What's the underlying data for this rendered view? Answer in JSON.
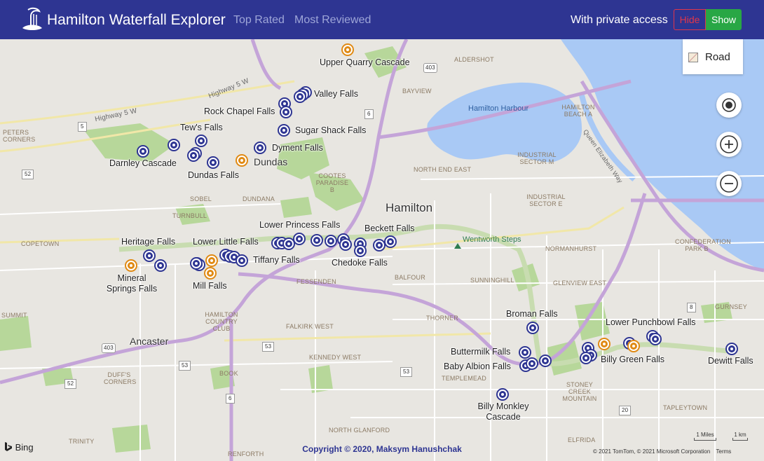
{
  "app": {
    "title": "Hamilton Waterfall Explorer",
    "nav": [
      "Top Rated",
      "Most Reviewed"
    ],
    "access_label": "With private access",
    "hide_label": "Hide",
    "show_label": "Show",
    "colors": {
      "header": "#2e3592",
      "hide": "#e0364a",
      "show": "#28a745",
      "pin_public": "#2e3592",
      "pin_private": "#e08a14"
    }
  },
  "map": {
    "style_label": "Road",
    "city": "Hamilton",
    "towns": [
      "Dundas",
      "Ancaster"
    ],
    "water": "Hamilton Harbour",
    "park": "Wentworth Steps",
    "roads": [
      "Highway 5 W",
      "Highway 5 W",
      "Queen Elizabeth Way"
    ],
    "shields": [
      "403",
      "6",
      "5",
      "52",
      "403",
      "53",
      "53",
      "53",
      "52",
      "6",
      "8",
      "20"
    ],
    "neighbourhoods": [
      "ALDERSHOT",
      "BAYVIEW",
      "PETERS CORNERS",
      "HAMILTON BEACH A",
      "NORTH END EAST",
      "INDUSTRIAL SECTOR M",
      "INDUSTRIAL SECTOR E",
      "COOTES PARADISE B",
      "SOBEL",
      "DUNDANA",
      "TURNBULL",
      "COPETOWN",
      "CONFEDERATION PARK B",
      "NORMANHURST",
      "GLENVIEW EAST",
      "FESSENDEN",
      "BALFOUR",
      "SUNNINGHILL",
      "SUMMIT",
      "HAMILTON COUNTRY CLUB",
      "FALKIRK WEST",
      "THORNER",
      "GURNSEY",
      "KENNEDY WEST",
      "DUFF'S CORNERS",
      "BOOK",
      "TEMPLEMEAD",
      "STONEY CREEK MOUNTAIN",
      "TAPLEYTOWN",
      "NORTH GLANFORD",
      "TRINITY",
      "RENFORTH",
      "ELFRIDA"
    ],
    "labels": [
      "Upper Quarry Cascade",
      "Valley Falls",
      "Rock Chapel Falls",
      "Sugar Shack Falls",
      "Tew's Falls",
      "Dyment Falls",
      "Darnley Cascade",
      "Dundas Falls",
      "Heritage Falls",
      "Lower Little Falls",
      "Lower Princess Falls",
      "Beckett Falls",
      "Tiffany Falls",
      "Chedoke Falls",
      "Mineral Springs Falls",
      "Mill Falls",
      "Broman Falls",
      "Lower Punchbowl Falls",
      "Buttermilk Falls",
      "Baby Albion Falls",
      "Billy Green Falls",
      "Dewitt Falls",
      "Billy Monkley Cascade"
    ],
    "pin_kinds": [
      "orange",
      "blue",
      "blue",
      "blue",
      "blue",
      "blue",
      "blue",
      "blue",
      "blue",
      "blue",
      "blue",
      "blue",
      "blue",
      "orange",
      "blue",
      "orange",
      "blue",
      "blue",
      "blue",
      "blue",
      "blue",
      "blue",
      "blue",
      "blue",
      "blue",
      "blue",
      "blue",
      "blue",
      "blue",
      "blue",
      "blue",
      "blue",
      "blue",
      "blue",
      "blue",
      "orange",
      "blue",
      "orange",
      "orange",
      "blue",
      "blue",
      "blue",
      "blue",
      "blue",
      "blue",
      "blue",
      "blue",
      "blue",
      "orange",
      "blue",
      "blue",
      "blue",
      "blue",
      "blue"
    ],
    "scale": [
      "1 Miles",
      "1 km"
    ],
    "attribution": "© 2021 TomTom, © 2021 Microsoft Corporation",
    "terms": "Terms",
    "bing": "Bing"
  },
  "footer": {
    "copyright": "Copyright © 2020, Maksym Hanushchak"
  }
}
